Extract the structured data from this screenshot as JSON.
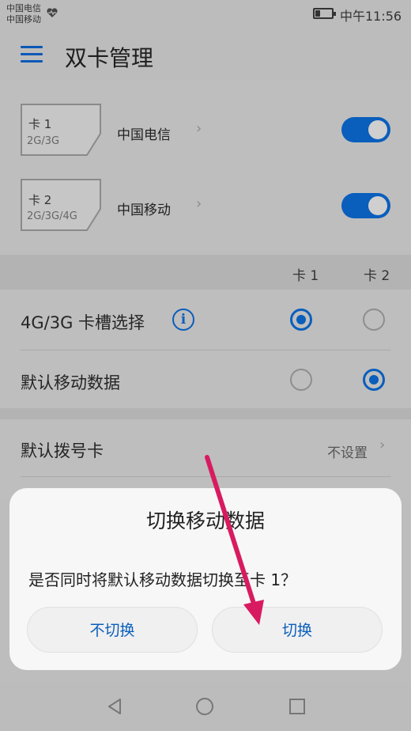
{
  "status_bar": {
    "carrier1": "中国电信",
    "carrier2": "中国移动",
    "time": "中午11:56"
  },
  "toolbar": {
    "title": "双卡管理"
  },
  "sims": [
    {
      "slot_label": "卡 1",
      "tech": "2G/3G",
      "carrier": "中国电信",
      "enabled": true
    },
    {
      "slot_label": "卡 2",
      "tech": "2G/3G/4G",
      "carrier": "中国移动",
      "enabled": true
    }
  ],
  "columns": {
    "card1": "卡 1",
    "card2": "卡 2"
  },
  "rows": [
    {
      "label": "4G/3G 卡槽选择",
      "selected": "card1",
      "info_icon": "info-icon"
    },
    {
      "label": "默认移动数据",
      "selected": "card2"
    }
  ],
  "default_dial": {
    "label": "默认拨号卡",
    "value": "不设置"
  },
  "dialog": {
    "title": "切换移动数据",
    "message": "是否同时将默认移动数据切换至卡 1？",
    "cancel_label": "不切换",
    "confirm_label": "切换"
  },
  "colors": {
    "accent": "#0a5ebc",
    "annotation_arrow": "#d81b60"
  }
}
